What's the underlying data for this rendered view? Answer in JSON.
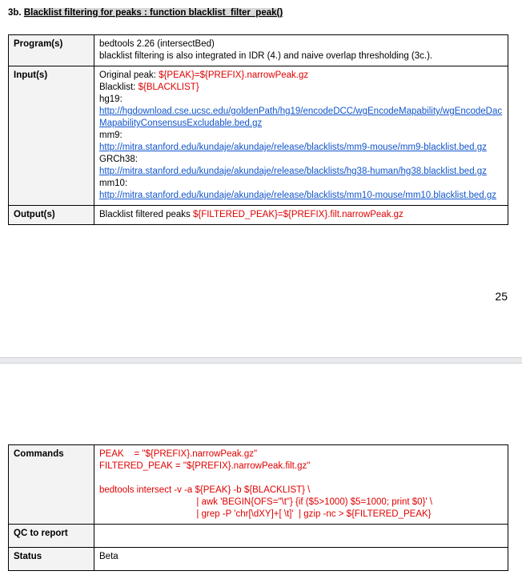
{
  "heading": {
    "prefix": "3b. ",
    "title": "Blacklist filtering for peaks : function blacklist_filter_peak()"
  },
  "table1": {
    "program_label": "Program(s)",
    "program_lines": [
      "bedtools 2.26 (intersectBed)",
      "blacklist filtering is also integrated in IDR (4.) and naive overlap thresholding (3c.)."
    ],
    "input_label": "Input(s)",
    "input": {
      "original_label": "Original peak: ",
      "original_value": "${PEAK}=${PREFIX}.narrowPeak.gz",
      "blacklist_label": "Blacklist: ",
      "blacklist_value": "${BLACKLIST}",
      "hg19_label": "hg19:",
      "hg19_url": "http://hgdownload.cse.ucsc.edu/goldenPath/hg19/encodeDCC/wgEncodeMapability/wgEncodeDacMapabilityConsensusExcludable.bed.gz",
      "mm9_label": "mm9:",
      "mm9_url": "http://mitra.stanford.edu/kundaje/akundaje/release/blacklists/mm9-mouse/mm9-blacklist.bed.gz",
      "grch38_label": "GRCh38:",
      "grch38_url": "http://mitra.stanford.edu/kundaje/akundaje/release/blacklists/hg38-human/hg38.blacklist.bed.gz",
      "mm10_label": "mm10:",
      "mm10_url": "http://mitra.stanford.edu/kundaje/akundaje/release/blacklists/mm10-mouse/mm10.blacklist.bed.gz"
    },
    "output_label": "Output(s)",
    "output_text": "Blacklist filtered peaks ",
    "output_value": "${FILTERED_PEAK}=${PREFIX}.filt.narrowPeak.gz"
  },
  "page_number": "25",
  "table2": {
    "commands_label": "Commands",
    "commands_text": "PEAK    = \"${PREFIX}.narrowPeak.gz\"\nFILTERED_PEAK = \"${PREFIX}.narrowPeak.filt.gz\"\n\nbedtools intersect -v -a ${PEAK} -b ${BLACKLIST} \\\n                                      | awk 'BEGIN{OFS=\"\\t\"} {if ($5>1000) $5=1000; print $0}' \\\n                                      | grep -P 'chr[\\dXY]+[ \\t]'  | gzip -nc > ${FILTERED_PEAK}",
    "qc_label": "QC to report",
    "qc_value": "",
    "status_label": "Status",
    "status_value": "Beta"
  }
}
